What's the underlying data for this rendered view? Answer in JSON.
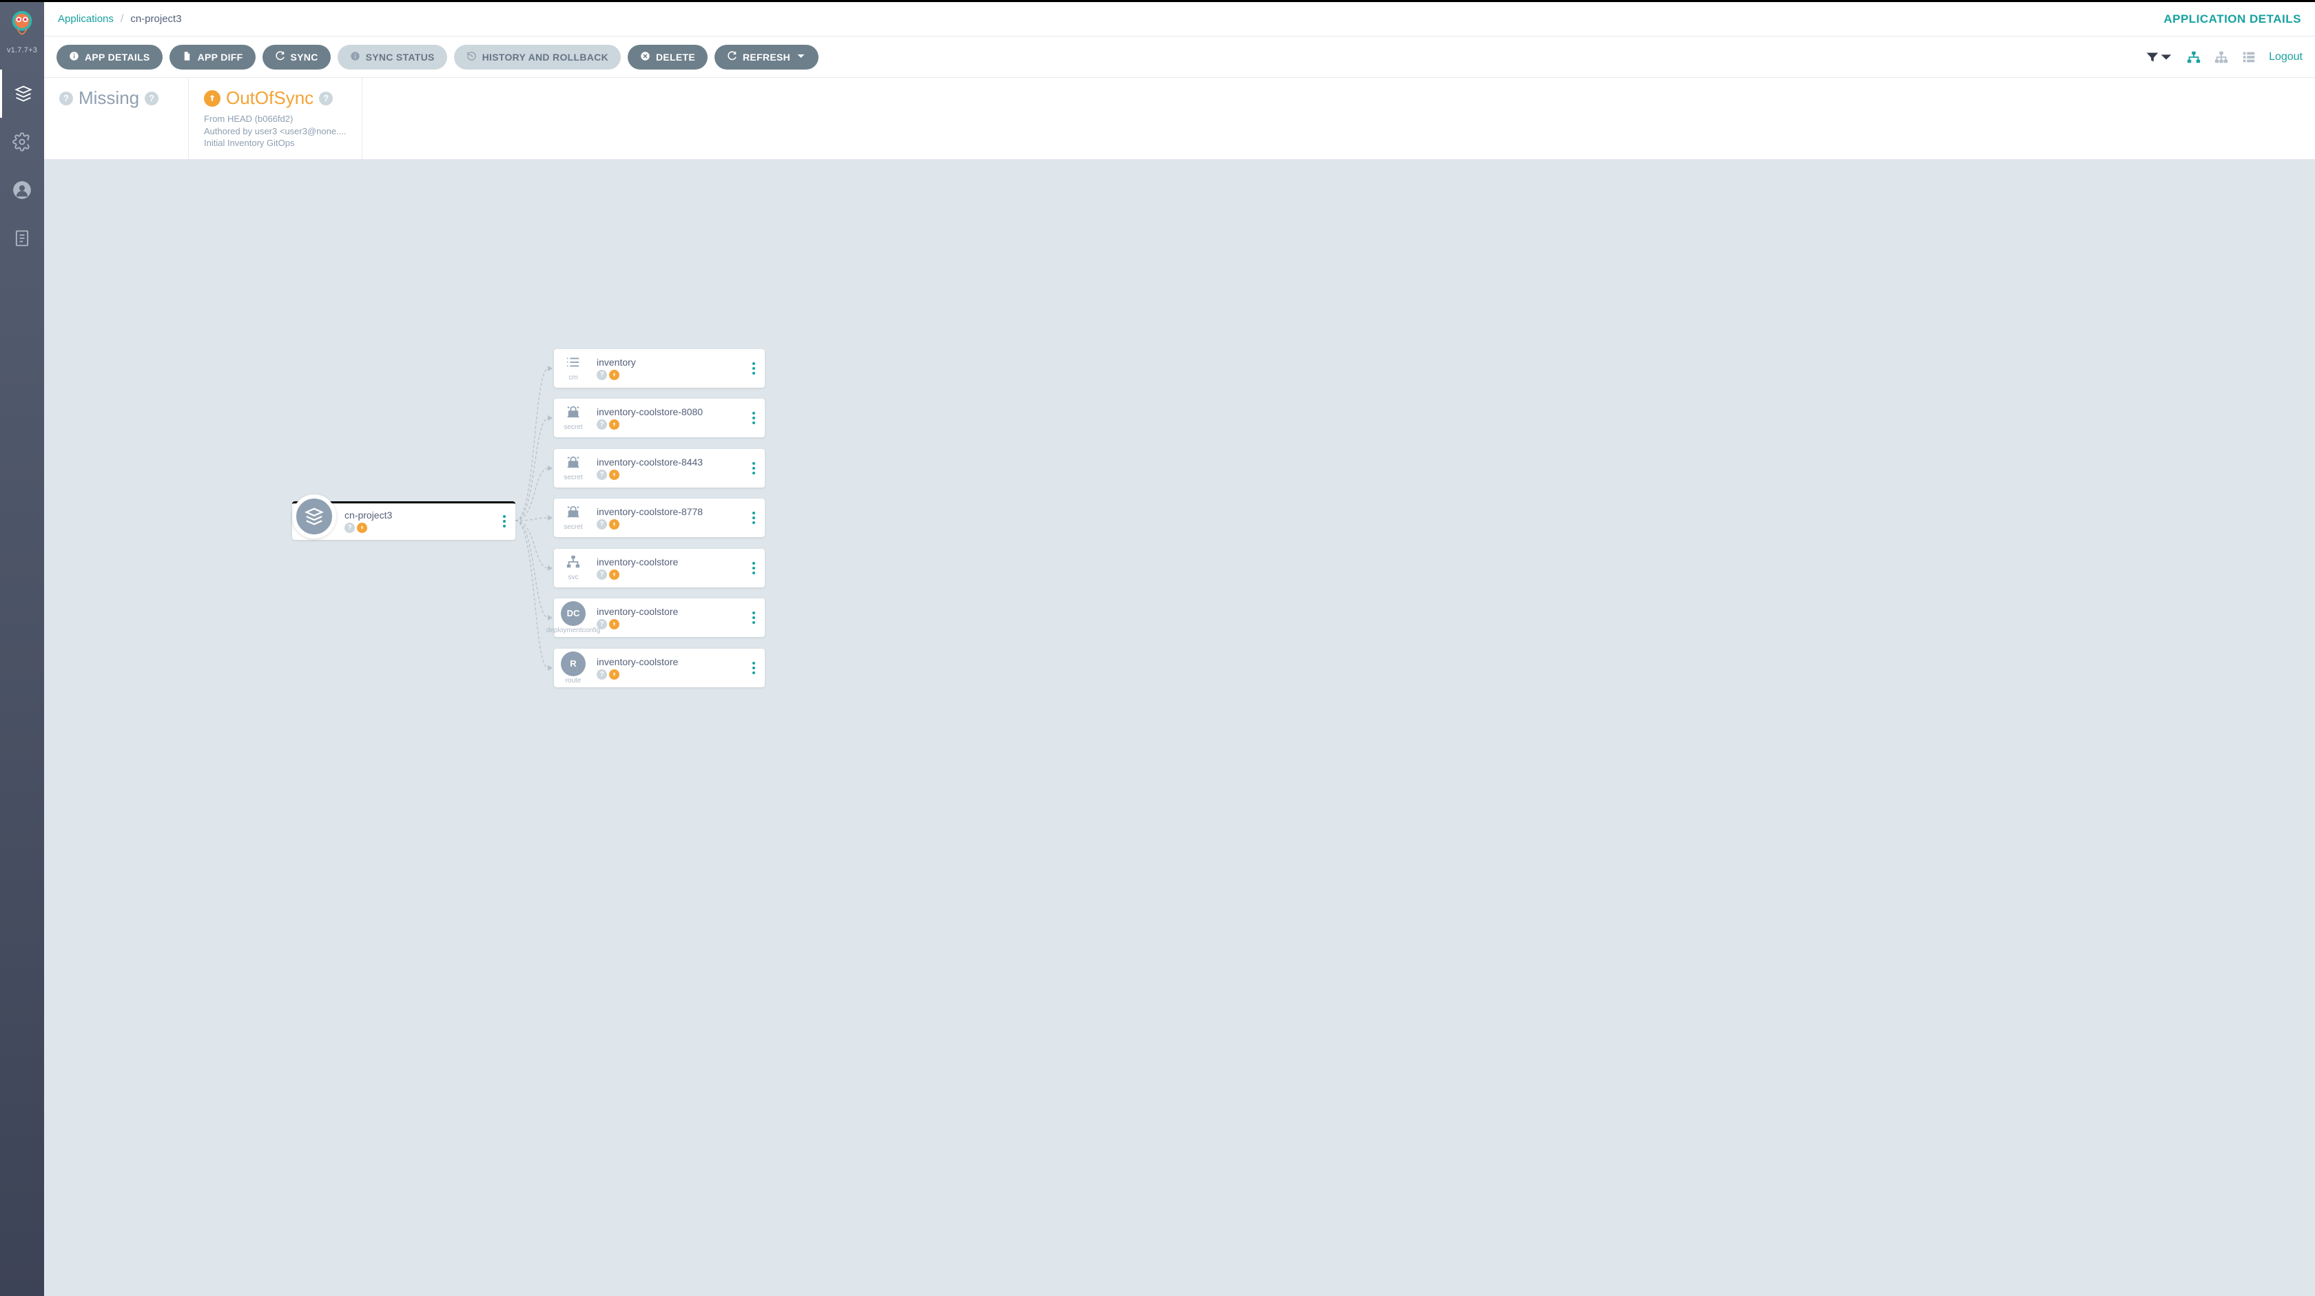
{
  "sidebar": {
    "version": "v1.7.7+3"
  },
  "breadcrumb": {
    "root": "Applications",
    "current": "cn-project3"
  },
  "page_title": "APPLICATION DETAILS",
  "toolbar": {
    "app_details": "APP DETAILS",
    "app_diff": "APP DIFF",
    "sync": "SYNC",
    "sync_status": "SYNC STATUS",
    "history": "HISTORY AND ROLLBACK",
    "delete": "DELETE",
    "refresh": "REFRESH",
    "logout": "Logout"
  },
  "status": {
    "health_label": "Missing",
    "sync_label": "OutOfSync",
    "sync_line1": "From HEAD (b066fd2)",
    "sync_line2": "Authored by user3 <user3@none....",
    "sync_line3": "Initial Inventory GitOps"
  },
  "tree": {
    "root": {
      "name": "cn-project3"
    },
    "children": [
      {
        "name": "inventory",
        "kind": "cm",
        "icon": "cm"
      },
      {
        "name": "inventory-coolstore-8080",
        "kind": "secret",
        "icon": "secret"
      },
      {
        "name": "inventory-coolstore-8443",
        "kind": "secret",
        "icon": "secret"
      },
      {
        "name": "inventory-coolstore-8778",
        "kind": "secret",
        "icon": "secret"
      },
      {
        "name": "inventory-coolstore",
        "kind": "svc",
        "icon": "svc"
      },
      {
        "name": "inventory-coolstore",
        "kind": "deploymentconfig",
        "icon": "dc",
        "letter": "DC"
      },
      {
        "name": "inventory-coolstore",
        "kind": "route",
        "icon": "letter",
        "letter": "R"
      }
    ]
  }
}
